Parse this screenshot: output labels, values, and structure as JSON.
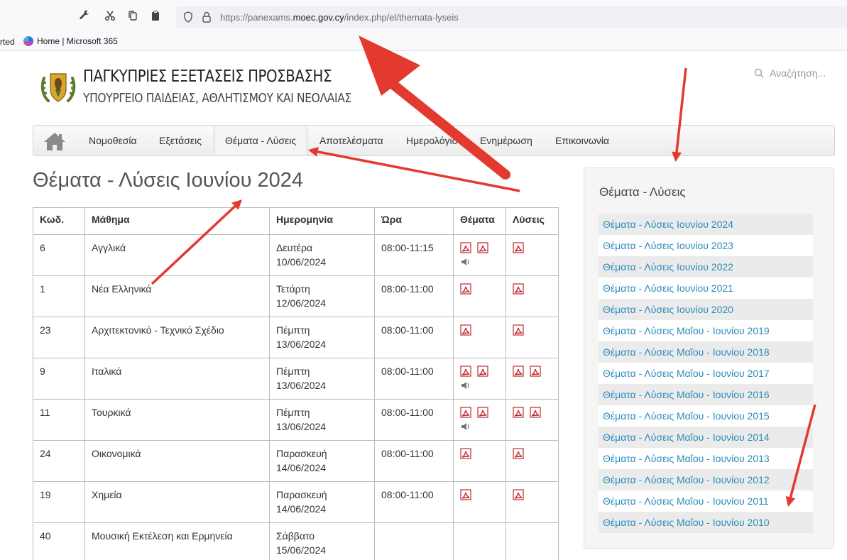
{
  "browser": {
    "url_prefix": "https://panexams.",
    "url_domain": "moec.gov.cy",
    "url_path": "/index.php/el/themata-lyseis",
    "bookmark_partial": "rted",
    "bookmark_home": "Home | Microsoft 365"
  },
  "site": {
    "title": "ΠΑΓΚΥΠΡΙΕΣ ΕΞΕΤΑΣΕΙΣ ΠΡΟΣΒΑΣΗΣ",
    "subtitle": "ΥΠΟΥΡΓΕΙΟ ΠΑΙΔΕΙΑΣ, ΑΘΛΗΤΙΣΜΟΥ ΚΑΙ ΝΕΟΛΑΙΑΣ",
    "search_placeholder": "Αναζήτηση..."
  },
  "nav": {
    "items": [
      "Νομοθεσία",
      "Εξετάσεις",
      "Θέματα - Λύσεις",
      "Αποτελέσματα",
      "Ημερολόγιο",
      "Ενημέρωση",
      "Επικοινωνία"
    ],
    "active": "Θέματα - Λύσεις"
  },
  "page": {
    "title": "Θέματα - Λύσεις Ιουνίου 2024"
  },
  "table": {
    "headers": [
      "Κωδ.",
      "Μάθημα",
      "Ημερομηνία",
      "Ώρα",
      "Θέματα",
      "Λύσεις"
    ],
    "rows": [
      {
        "code": "6",
        "subject": "Αγγλικά",
        "day": "Δευτέρα",
        "date": "10/06/2024",
        "time": "08:00-11:15",
        "exam_pdfs": 2,
        "exam_audio": true,
        "solution_pdfs": 1
      },
      {
        "code": "1",
        "subject": "Νέα Ελληνικά",
        "day": "Τετάρτη",
        "date": "12/06/2024",
        "time": "08:00-11:00",
        "exam_pdfs": 1,
        "exam_audio": false,
        "solution_pdfs": 1
      },
      {
        "code": "23",
        "subject": "Αρχιτεκτονικό - Τεχνικό Σχέδιο",
        "day": "Πέμπτη",
        "date": "13/06/2024",
        "time": "08:00-11:00",
        "exam_pdfs": 1,
        "exam_audio": false,
        "solution_pdfs": 1
      },
      {
        "code": "9",
        "subject": "Ιταλικά",
        "day": "Πέμπτη",
        "date": "13/06/2024",
        "time": "08:00-11:00",
        "exam_pdfs": 2,
        "exam_audio": true,
        "solution_pdfs": 2
      },
      {
        "code": "11",
        "subject": "Τουρκικά",
        "day": "Πέμπτη",
        "date": "13/06/2024",
        "time": "08:00-11:00",
        "exam_pdfs": 2,
        "exam_audio": true,
        "solution_pdfs": 2
      },
      {
        "code": "24",
        "subject": "Οικονομικά",
        "day": "Παρασκευή",
        "date": "14/06/2024",
        "time": "08:00-11:00",
        "exam_pdfs": 1,
        "exam_audio": false,
        "solution_pdfs": 1
      },
      {
        "code": "19",
        "subject": "Χημεία",
        "day": "Παρασκευή",
        "date": "14/06/2024",
        "time": "08:00-11:00",
        "exam_pdfs": 1,
        "exam_audio": false,
        "solution_pdfs": 1
      },
      {
        "code": "40",
        "subject": "Μουσική Εκτέλεση και Ερμηνεία",
        "day": "Σάββατο",
        "date": "15/06/2024",
        "time": "",
        "exam_pdfs": 0,
        "exam_audio": false,
        "solution_pdfs": 0
      }
    ]
  },
  "sidebar": {
    "title": "Θέματα - Λύσεις",
    "links": [
      "Θέματα - Λύσεις Ιουνίου 2024",
      "Θέματα - Λύσεις Ιουνίου 2023",
      "Θέματα - Λύσεις Ιουνίου 2022",
      "Θέματα - Λύσεις Ιουνίου 2021",
      "Θέματα - Λύσεις Ιουνίου 2020",
      "Θέματα - Λύσεις Μαΐου - Ιουνίου 2019",
      "Θέματα - Λύσεις Μαΐου - Ιουνίου 2018",
      "Θέματα - Λύσεις Μαΐου - Ιουνίου 2017",
      "Θέματα - Λύσεις Μαΐου - Ιουνίου 2016",
      "Θέματα - Λύσεις Μαΐου - Ιουνίου 2015",
      "Θέματα - Λύσεις Μαΐου - Ιουνίου 2014",
      "Θέματα - Λύσεις Μαΐου - Ιουνίου 2013",
      "Θέματα - Λύσεις Μαΐου - Ιουνίου 2012",
      "Θέματα - Λύσεις Μαΐου - Ιουνίου 2011",
      "Θέματα - Λύσεις Μαΐου - Ιουνίου 2010"
    ]
  },
  "colors": {
    "link": "#2a8cbc",
    "annotation_arrow": "#e33a2f",
    "pdf_icon": "#c0282d"
  }
}
